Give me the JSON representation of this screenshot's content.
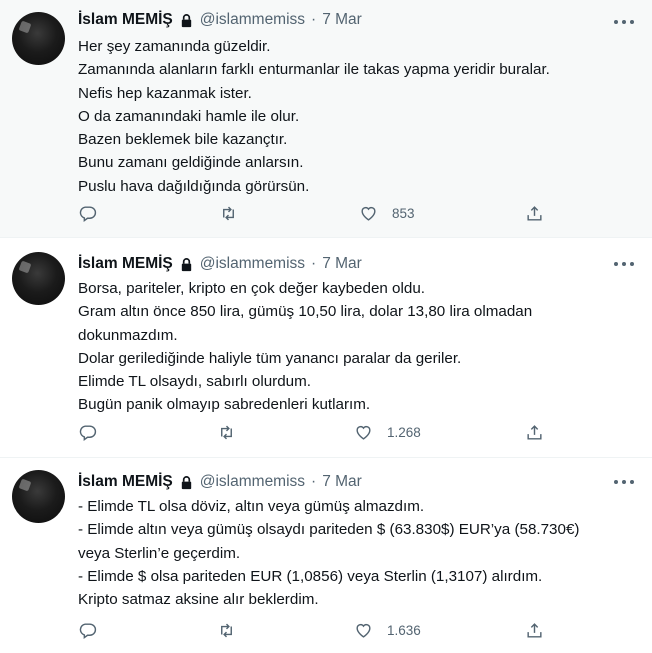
{
  "tweets": [
    {
      "name": "İslam MEMİŞ",
      "handle": "@islammemiss",
      "separator": "·",
      "date": "7 Mar",
      "lines": [
        "Her şey zamanında güzeldir.",
        "Zamanında alanların farklı enturmanlar ile takas yapma yeridir buralar.",
        "Nefis hep kazanmak ister.",
        "O da zamanındaki hamle ile olur.",
        "Bazen beklemek bile kazançtır.",
        "Bunu zamanı geldiğinde anlarsın.",
        "Puslu hava dağıldığında görürsün."
      ],
      "likes": "853"
    },
    {
      "name": "İslam MEMİŞ",
      "handle": "@islammemiss",
      "separator": "·",
      "date": "7 Mar",
      "lines": [
        "Borsa, pariteler, kripto en çok değer kaybeden oldu.",
        "Gram altın önce 850 lira, gümüş 10,50 lira, dolar 13,80 lira olmadan",
        "dokunmazdım.",
        "Dolar gerilediğinde haliyle tüm yanancı paralar da geriler.",
        "Elimde TL olsaydı, sabırlı olurdum.",
        "Bugün panik olmayıp sabredenleri kutlarım."
      ],
      "likes": "1.268"
    },
    {
      "name": "İslam MEMİŞ",
      "handle": "@islammemiss",
      "separator": "·",
      "date": "7 Mar",
      "lines": [
        "- Elimde TL olsa döviz, altın veya gümüş almazdım.",
        "- Elimde altın veya gümüş olsaydı pariteden $ (63.830$) EUR’ya (58.730€)",
        "veya Sterlin’e geçerdim.",
        "- Elimde $ olsa pariteden EUR (1,0856) veya Sterlin (1,3107) alırdım.",
        "Kripto satmaz aksine alır beklerdim."
      ],
      "likes": "1.636"
    }
  ],
  "icons": {
    "more": "more-horizontal-icon",
    "reply": "reply-icon",
    "retweet": "retweet-icon",
    "like": "heart-icon",
    "share": "share-icon",
    "lock": "lock-icon"
  },
  "colors": {
    "text": "#0f1419",
    "secondary": "#536471",
    "highlight_bg": "#f7f9f9",
    "divider": "#eff3f4"
  }
}
